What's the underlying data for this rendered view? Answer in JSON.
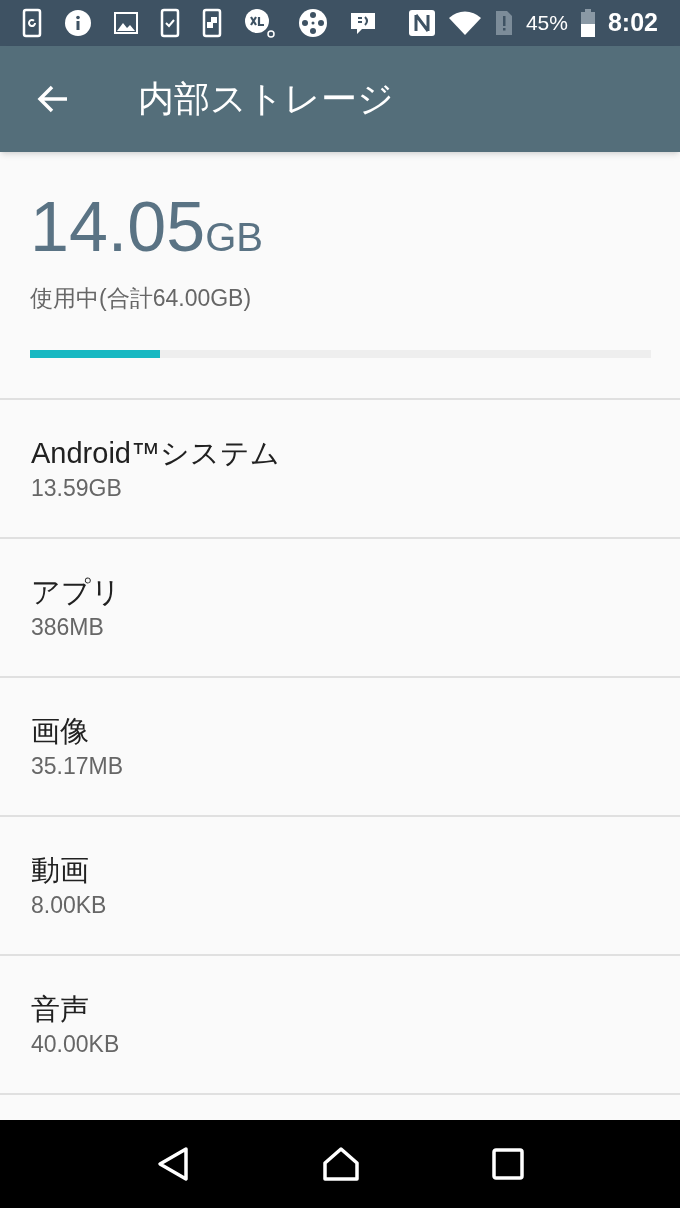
{
  "status_bar": {
    "battery_percent": "45%",
    "time": "8:02"
  },
  "app_bar": {
    "title": "内部ストレージ"
  },
  "summary": {
    "used_value": "14.05",
    "used_unit": "GB",
    "caption": "使用中(合計64.00GB)",
    "level": 0.21
  },
  "items": [
    {
      "title": "Android™システム",
      "size": "13.59GB"
    },
    {
      "title": "アプリ",
      "size": "386MB"
    },
    {
      "title": "画像",
      "size": "35.17MB"
    },
    {
      "title": "動画",
      "size": "8.00KB"
    },
    {
      "title": "音声",
      "size": "40.00KB"
    }
  ]
}
